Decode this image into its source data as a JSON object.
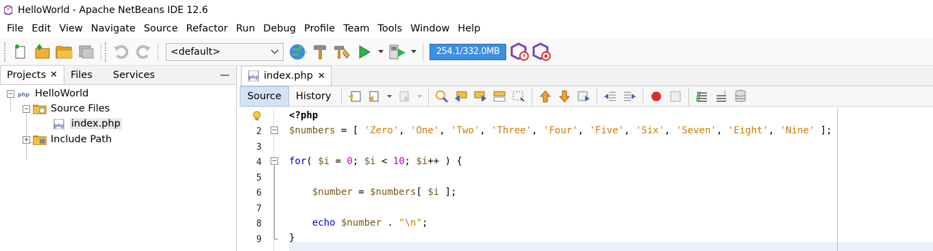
{
  "window": {
    "title": "HelloWorld - Apache NetBeans IDE 12.6"
  },
  "menu": [
    "File",
    "Edit",
    "View",
    "Navigate",
    "Source",
    "Refactor",
    "Run",
    "Debug",
    "Profile",
    "Team",
    "Tools",
    "Window",
    "Help"
  ],
  "toolbar": {
    "configuration": "<default>",
    "memory": "254.1/332.0MB"
  },
  "left_panel": {
    "tabs": [
      "Projects",
      "Files",
      "Services"
    ],
    "tree": {
      "project": "HelloWorld",
      "source_files": "Source Files",
      "file": "index.php",
      "include_path": "Include Path"
    }
  },
  "editor": {
    "tab": "index.php",
    "views": {
      "source": "Source",
      "history": "History"
    },
    "line_numbers": [
      "",
      "2",
      "3",
      "4",
      "5",
      "6",
      "7",
      "8",
      "9"
    ],
    "lines": [
      "<?php",
      "$numbers = [ 'Zero', 'One', 'Two', 'Three', 'Four', 'Five', 'Six', 'Seven', 'Eight', 'Nine' ];",
      "",
      "for( $i = 0; $i < 10; $i++ ) {",
      "",
      "    $number = $numbers[ $i ];",
      "",
      "    echo $number . \"\\n\";",
      "}"
    ]
  },
  "colors": {
    "accent": "#3d8fe0",
    "keyword": "#0000e6",
    "string": "#ce7b00",
    "number": "#c000c0",
    "margin": "#f3a0a0"
  }
}
